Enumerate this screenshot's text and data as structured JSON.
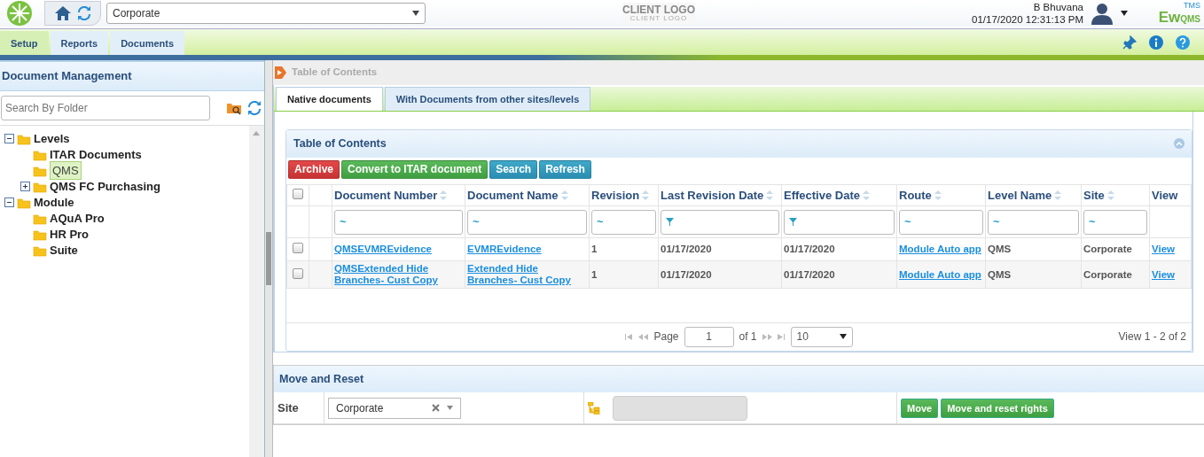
{
  "header": {
    "site_select": "Corporate",
    "client_logo": {
      "main": "CLIENT LOGO",
      "sub": "CLIENT LOGO"
    },
    "user_name": "B Bhuvana",
    "datetime": "01/17/2020 12:31:13 PM",
    "brand": {
      "main": "Ew",
      "sub": "QMS",
      "sup": "TMS"
    }
  },
  "menu_tabs": [
    {
      "label": "Setup",
      "selected": true
    },
    {
      "label": "Reports",
      "selected": false
    },
    {
      "label": "Documents",
      "selected": false
    }
  ],
  "sidebar": {
    "title": "Document Management",
    "search": {
      "placeholder": "Search By Folder"
    },
    "tree": [
      {
        "label": "Levels",
        "expanded": true,
        "selected": false,
        "children": [
          {
            "label": "ITAR Documents",
            "selected": false
          },
          {
            "label": "QMS",
            "selected": true
          },
          {
            "label": "QMS FC Purchasing",
            "expanded": false,
            "selected": false
          }
        ]
      },
      {
        "label": "Module",
        "expanded": true,
        "selected": false,
        "children": [
          {
            "label": "AQuA Pro",
            "selected": false
          },
          {
            "label": "HR Pro",
            "selected": false
          },
          {
            "label": "Suite",
            "selected": false
          }
        ]
      }
    ]
  },
  "breadcrumb": [
    "Table of Contents"
  ],
  "content_tabs": [
    {
      "label": "Native documents",
      "selected": true
    },
    {
      "label": "With Documents from other sites/levels",
      "selected": false
    }
  ],
  "toc_panel": {
    "title": "Table of Contents",
    "buttons": [
      {
        "label": "Archive",
        "kind": "danger"
      },
      {
        "label": "Convert to ITAR document",
        "kind": "success"
      },
      {
        "label": "Search",
        "kind": "info"
      },
      {
        "label": "Refresh",
        "kind": "info"
      }
    ],
    "select_all_checked": false,
    "columns": [
      {
        "kind": "data",
        "label": "Document Number",
        "filter_symbol": "~"
      },
      {
        "kind": "data",
        "label": "Document Name",
        "filter_symbol": "~"
      },
      {
        "kind": "data",
        "label": "Revision",
        "filter_symbol": "~"
      },
      {
        "kind": "data",
        "label": "Last Revision Date",
        "filter_icon": true
      },
      {
        "kind": "data",
        "label": "Effective Date",
        "filter_icon": true
      },
      {
        "kind": "data",
        "label": "Route",
        "filter_symbol": "~"
      },
      {
        "kind": "data",
        "label": "Level Name",
        "filter_symbol": "~"
      },
      {
        "kind": "data",
        "label": "Site",
        "filter_symbol": "~"
      },
      {
        "kind": "plain",
        "label": "View"
      }
    ],
    "rows": [
      {
        "checked": false,
        "cells": [
          {
            "text": "QMSEVMREvidence",
            "link": true
          },
          {
            "text": "EVMREvidence",
            "link": true
          },
          {
            "text": "1",
            "link": false
          },
          {
            "text": "01/17/2020",
            "link": false
          },
          {
            "text": "01/17/2020",
            "link": false
          },
          {
            "text": "Module Auto app",
            "link": true
          },
          {
            "text": "QMS",
            "link": false
          },
          {
            "text": "Corporate",
            "link": false
          },
          {
            "text": "View",
            "link": true
          }
        ]
      },
      {
        "checked": false,
        "cells": [
          {
            "text": "QMSExtended Hide Branches- Cust Copy",
            "link": true
          },
          {
            "text": "Extended Hide Branches- Cust Copy",
            "link": true
          },
          {
            "text": "1",
            "link": false
          },
          {
            "text": "01/17/2020",
            "link": false
          },
          {
            "text": "01/17/2020",
            "link": false
          },
          {
            "text": "Module Auto app",
            "link": true
          },
          {
            "text": "QMS",
            "link": false
          },
          {
            "text": "Corporate",
            "link": false
          },
          {
            "text": "View",
            "link": true
          }
        ]
      }
    ],
    "pager": {
      "page_label": "Page",
      "page": "1",
      "of": "of 1",
      "page_size": "10",
      "summary": "View 1 - 2 of 2"
    }
  },
  "move_panel": {
    "title": "Move and Reset",
    "site_label": "Site",
    "site_value": "Corporate",
    "buttons": [
      "Move",
      "Move and reset rights"
    ]
  }
}
